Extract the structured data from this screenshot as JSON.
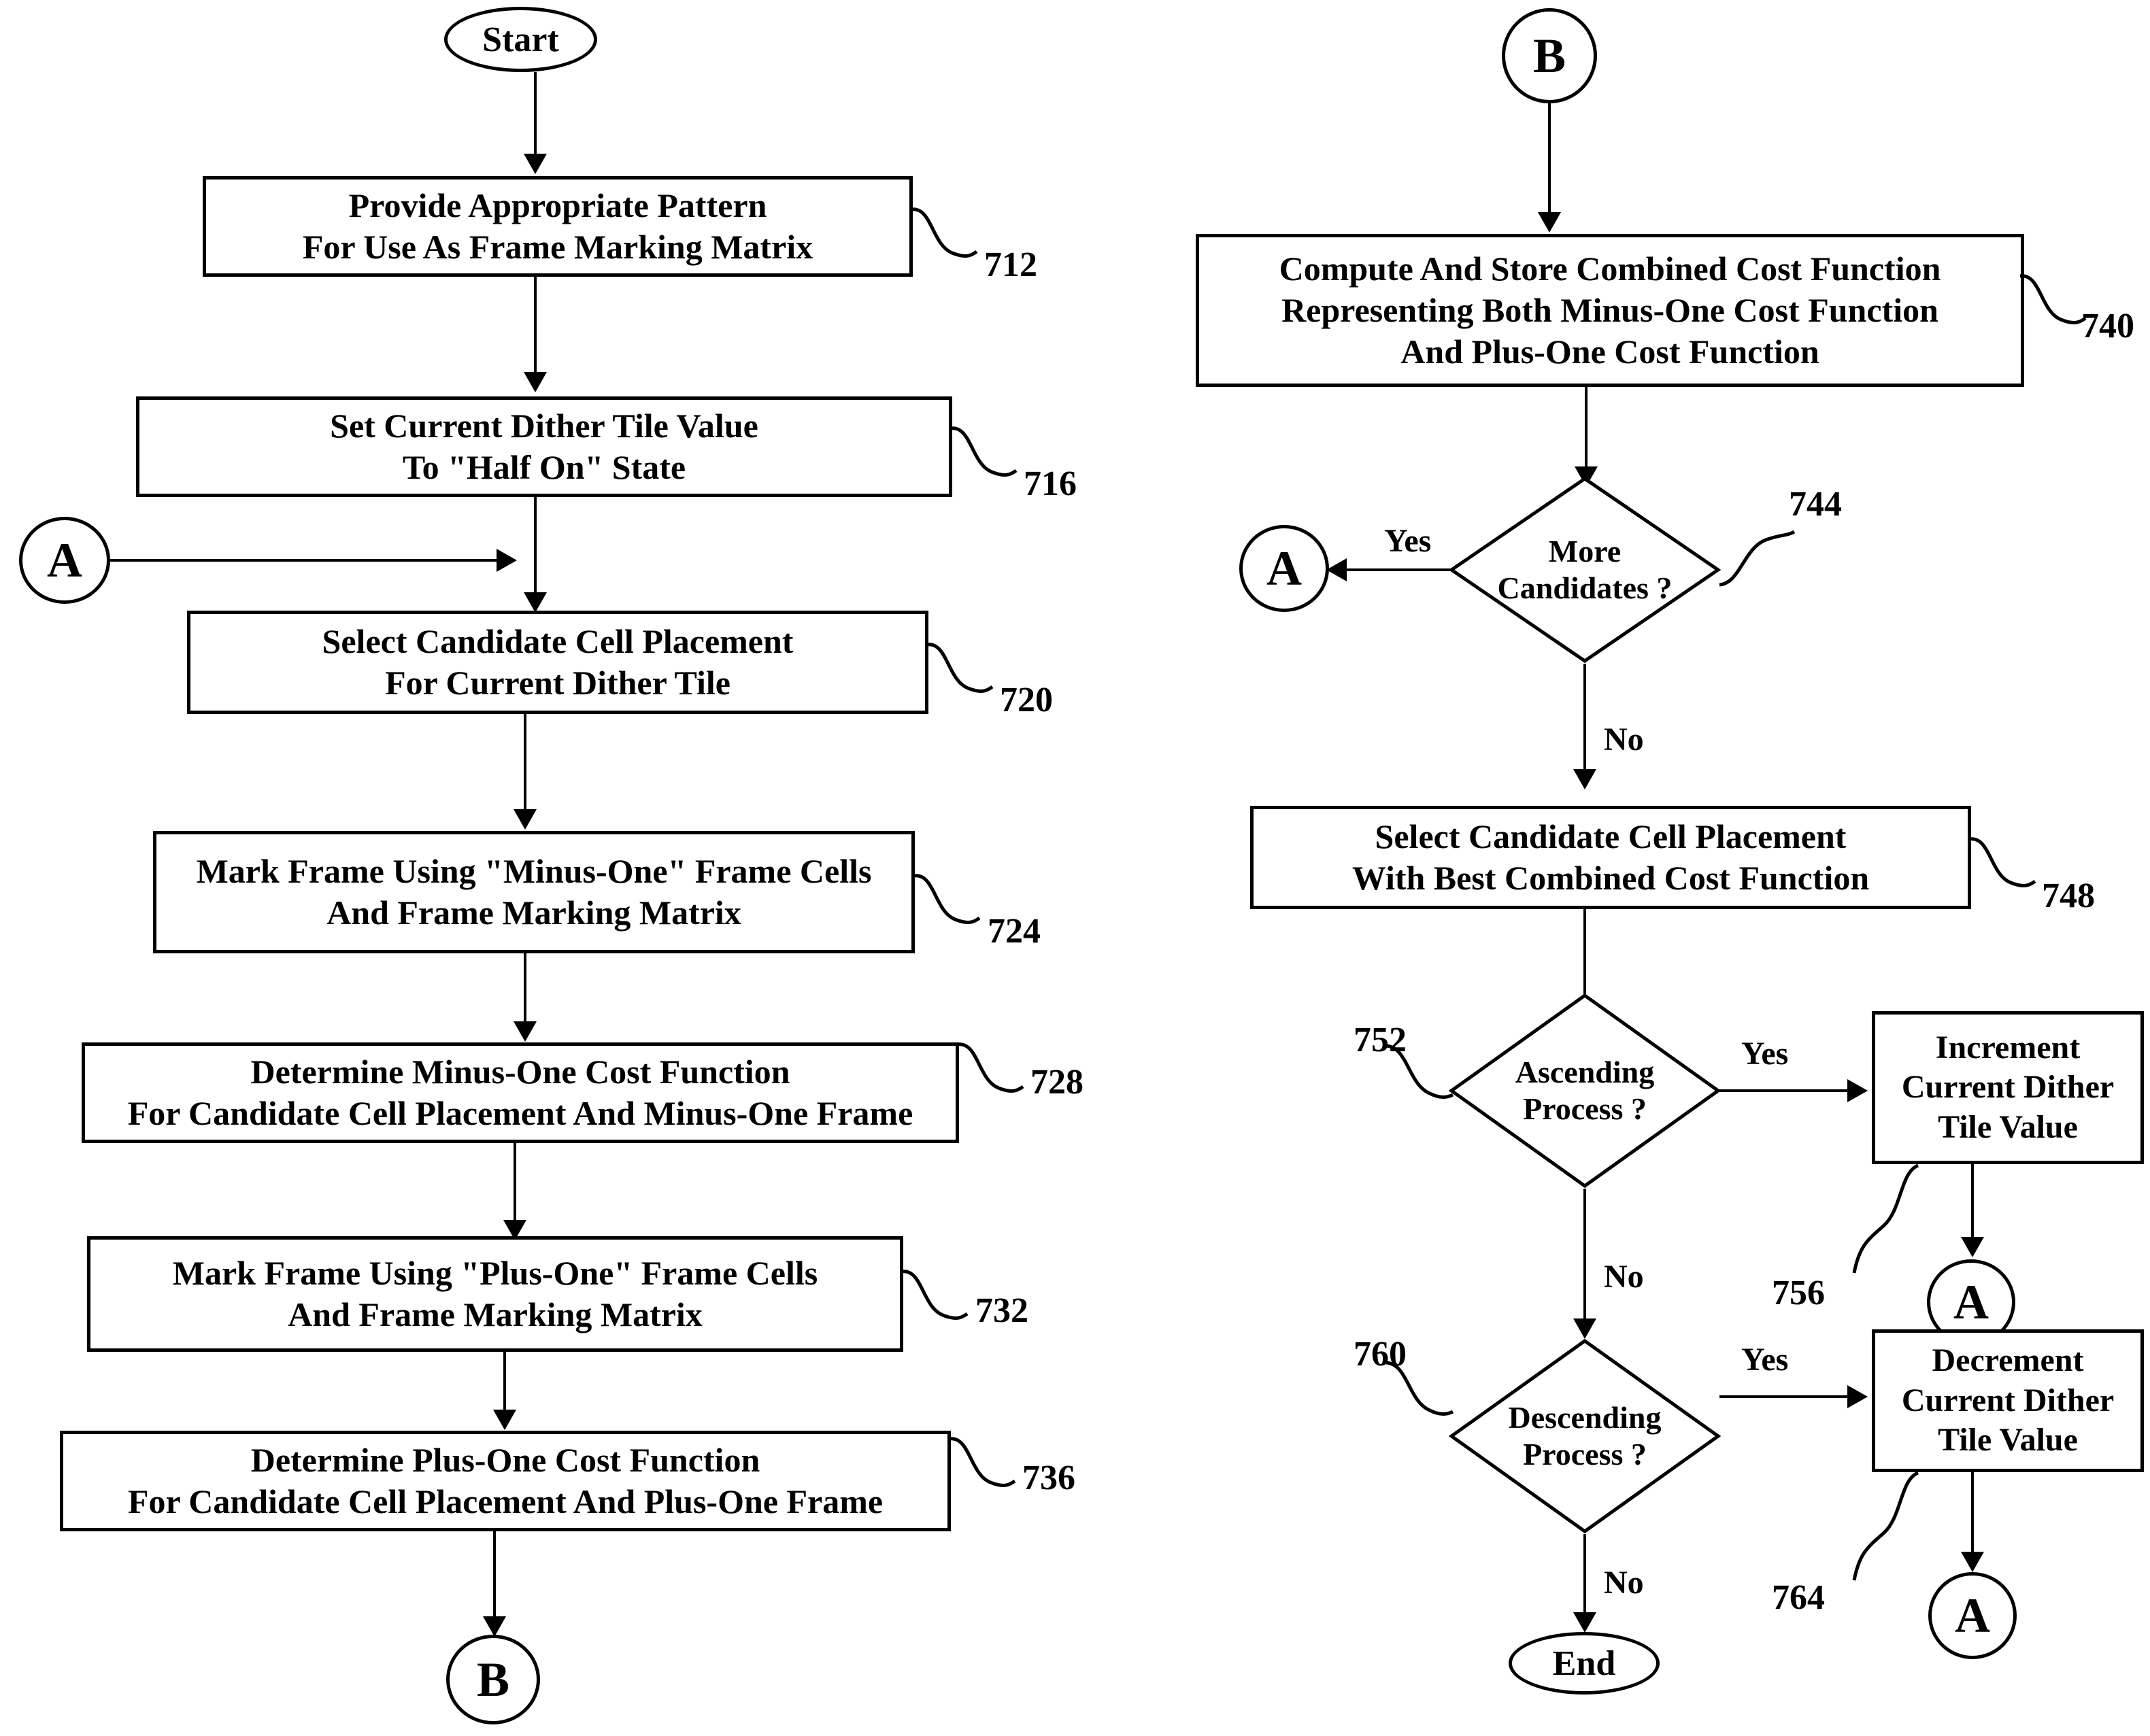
{
  "figure": {
    "type": "patent-flowchart",
    "stroke_color": "#000000",
    "background_color": "#ffffff"
  },
  "left_column": {
    "start_terminal": {
      "label": "Start"
    },
    "steps": [
      {
        "ref": "712",
        "lines": [
          "Provide Appropriate Pattern",
          "For Use As Frame Marking Matrix"
        ]
      },
      {
        "ref": "716",
        "lines": [
          "Set Current Dither Tile Value",
          "To \"Half On\" State"
        ]
      },
      {
        "ref": "720",
        "lines": [
          "Select Candidate Cell Placement",
          "For Current Dither Tile"
        ]
      },
      {
        "ref": "724",
        "lines": [
          "Mark Frame Using \"Minus-One\" Frame Cells",
          "And Frame Marking Matrix"
        ]
      },
      {
        "ref": "728",
        "lines": [
          "Determine Minus-One Cost Function",
          "For Candidate Cell Placement And Minus-One Frame"
        ]
      },
      {
        "ref": "732",
        "lines": [
          "Mark Frame Using \"Plus-One\" Frame Cells",
          "And Frame Marking Matrix"
        ]
      },
      {
        "ref": "736",
        "lines": [
          "Determine Plus-One Cost Function",
          "For Candidate Cell Placement And Plus-One Frame"
        ]
      }
    ],
    "entry_connector": {
      "label": "A"
    },
    "exit_connector": {
      "label": "B"
    }
  },
  "right_column": {
    "entry_connector": {
      "label": "B"
    },
    "step_740": {
      "ref": "740",
      "lines": [
        "Compute And Store Combined Cost Function",
        "Representing Both Minus-One Cost Function",
        "And Plus-One Cost Function"
      ]
    },
    "decision_744": {
      "ref": "744",
      "lines": [
        "More",
        "Candidates ?"
      ],
      "yes_label": "Yes",
      "no_label": "No",
      "yes_target": "A"
    },
    "step_748": {
      "ref": "748",
      "lines": [
        "Select Candidate Cell Placement",
        "With Best Combined Cost Function"
      ]
    },
    "decision_752": {
      "ref": "752",
      "lines": [
        "Ascending",
        "Process ?"
      ],
      "yes_label": "Yes",
      "no_label": "No"
    },
    "step_756": {
      "ref": "756",
      "lines": [
        "Increment",
        "Current Dither",
        "Tile Value"
      ],
      "target": "A"
    },
    "decision_760": {
      "ref": "760",
      "lines": [
        "Descending",
        "Process ?"
      ],
      "yes_label": "Yes",
      "no_label": "No"
    },
    "step_764": {
      "ref": "764",
      "lines": [
        "Decrement",
        "Current Dither",
        "Tile Value"
      ],
      "target": "A"
    },
    "end_terminal": {
      "label": "End"
    }
  }
}
